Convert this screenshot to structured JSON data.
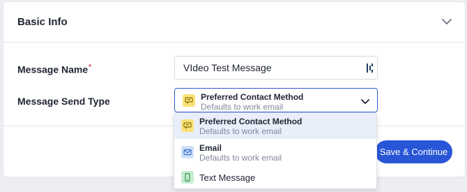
{
  "section": {
    "title": "Basic Info",
    "collapse_icon": "chevron-down-icon"
  },
  "form": {
    "message_name": {
      "label": "Message Name",
      "required_marker": "*",
      "value": "VIdeo Test Message",
      "icon": "field-options-icon"
    },
    "send_type": {
      "label": "Message Send Type",
      "selected_title": "Preferred Contact Method",
      "selected_sub": "Defaults to work email",
      "selected_icon": "chat-icon",
      "options": [
        {
          "title": "Preferred Contact Method",
          "sub": "Defaults to work email",
          "icon": "chat-icon",
          "color": "#f7e27a",
          "selected": true
        },
        {
          "title": "Email",
          "sub": "Defaults to work email",
          "icon": "mail-icon",
          "color": "#cfe0fb",
          "selected": false
        },
        {
          "title": "Text Message",
          "sub": "",
          "icon": "phone-icon",
          "color": "#c6ecd0",
          "selected": false
        }
      ]
    }
  },
  "actions": {
    "save_label": "Save & Continue"
  },
  "colors": {
    "accent": "#2856d6",
    "focus_border": "#2f5bd6",
    "required": "#e0334a"
  }
}
